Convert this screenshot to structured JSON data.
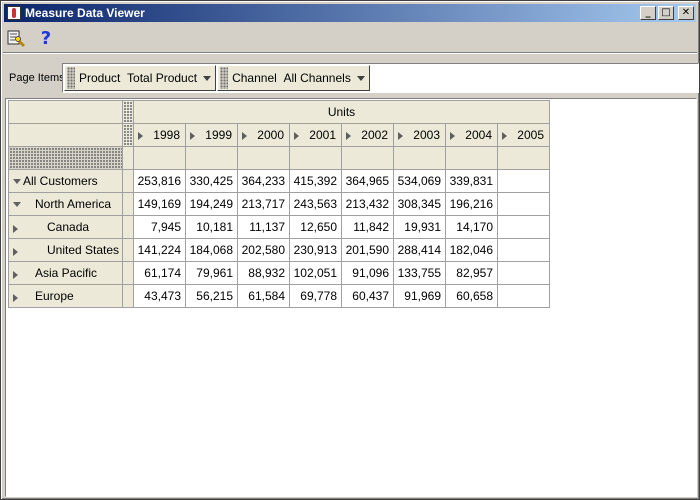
{
  "window": {
    "title": "Measure Data Viewer",
    "controls": {
      "minimize": "_",
      "maximize": "□",
      "close": "✕"
    }
  },
  "toolbar": {
    "icons": [
      "query-wizard-icon",
      "help-icon"
    ],
    "help_glyph": "?"
  },
  "page_items": {
    "label": "Page Items",
    "dimensions": [
      {
        "name": "Product",
        "value": "Total Product"
      },
      {
        "name": "Channel",
        "value": "All Channels"
      }
    ]
  },
  "grid": {
    "measure": "Units",
    "years": [
      "1998",
      "1999",
      "2000",
      "2001",
      "2002",
      "2003",
      "2004",
      "2005"
    ],
    "rows": [
      {
        "label": "All Customers",
        "level": 0,
        "expanded": true,
        "values": [
          "253,816",
          "330,425",
          "364,233",
          "415,392",
          "364,965",
          "534,069",
          "339,831",
          ""
        ]
      },
      {
        "label": "North America",
        "level": 1,
        "expanded": true,
        "values": [
          "149,169",
          "194,249",
          "213,717",
          "243,563",
          "213,432",
          "308,345",
          "196,216",
          ""
        ]
      },
      {
        "label": "Canada",
        "level": 2,
        "expanded": false,
        "values": [
          "7,945",
          "10,181",
          "11,137",
          "12,650",
          "11,842",
          "19,931",
          "14,170",
          ""
        ]
      },
      {
        "label": "United States",
        "level": 2,
        "expanded": false,
        "values": [
          "141,224",
          "184,068",
          "202,580",
          "230,913",
          "201,590",
          "288,414",
          "182,046",
          ""
        ]
      },
      {
        "label": "Asia Pacific",
        "level": 1,
        "expanded": false,
        "values": [
          "61,174",
          "79,961",
          "88,932",
          "102,051",
          "91,096",
          "133,755",
          "82,957",
          ""
        ]
      },
      {
        "label": "Europe",
        "level": 1,
        "expanded": false,
        "values": [
          "43,473",
          "56,215",
          "61,584",
          "69,778",
          "60,437",
          "91,969",
          "60,658",
          ""
        ]
      }
    ]
  }
}
